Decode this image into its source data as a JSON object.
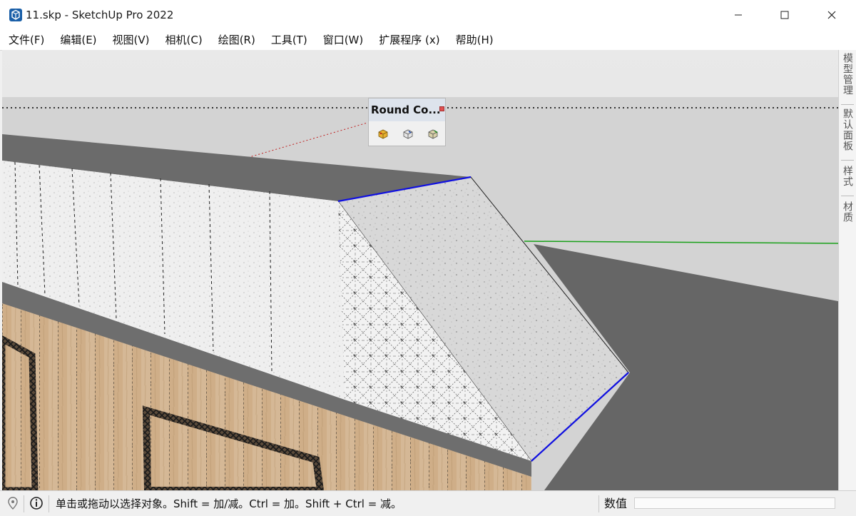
{
  "window": {
    "title": "11.skp - SketchUp Pro 2022",
    "minimize_icon": "minimize-icon",
    "maximize_icon": "maximize-icon",
    "close_icon": "close-icon"
  },
  "menu": [
    {
      "label": "文件(F)"
    },
    {
      "label": "编辑(E)"
    },
    {
      "label": "视图(V)"
    },
    {
      "label": "相机(C)"
    },
    {
      "label": "绘图(R)"
    },
    {
      "label": "工具(T)"
    },
    {
      "label": "窗口(W)"
    },
    {
      "label": "扩展程序 (x)"
    },
    {
      "label": "帮助(H)"
    }
  ],
  "tray_tabs": [
    {
      "label": "模型管理"
    },
    {
      "label": "默认面板"
    },
    {
      "label": "样式"
    },
    {
      "label": "材质"
    }
  ],
  "round_corner_toolbar": {
    "title": "Round Co...",
    "tools": [
      "round-corner-icon",
      "sharp-corner-icon",
      "bevel-icon"
    ]
  },
  "status": {
    "hint": "单击或拖动以选择对象。Shift = 加/减。Ctrl = 加。Shift + Ctrl = 减。",
    "vcb_label": "数值",
    "vcb_value": ""
  },
  "colors": {
    "selection_edge": "#1010e0",
    "green_axis": "#19a019",
    "red_axis": "#c02020"
  }
}
